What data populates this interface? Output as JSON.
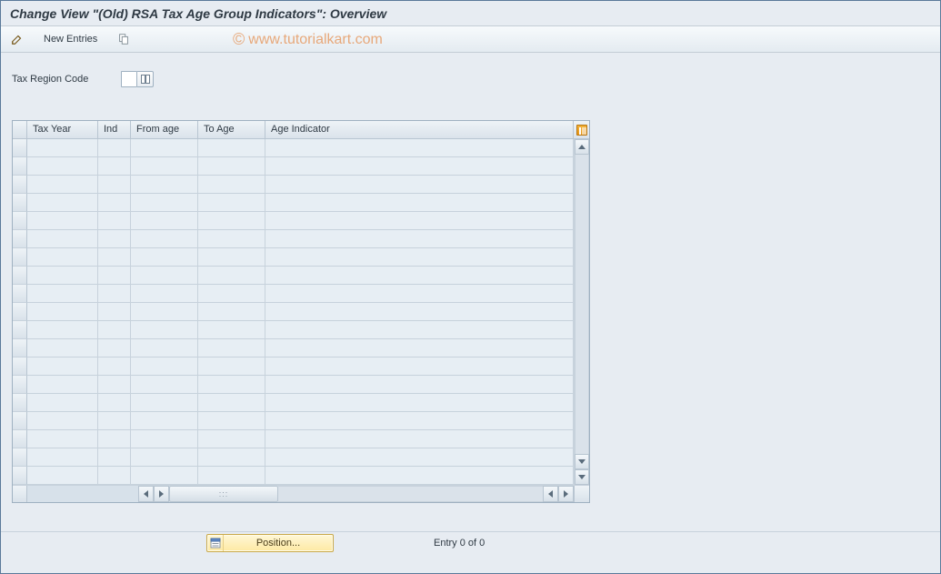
{
  "title": "Change View \"(Old) RSA Tax Age Group Indicators\": Overview",
  "toolbar": {
    "new_entries_label": "New Entries"
  },
  "watermark": "www.tutorialkart.com",
  "form": {
    "tax_region_label": "Tax Region Code",
    "tax_region_value": ""
  },
  "table": {
    "columns": {
      "tax_year": "Tax Year",
      "ind": "Ind",
      "from_age": "From age",
      "to_age": "To Age",
      "age_indicator": "Age Indicator"
    },
    "rows": [
      {
        "tax_year": "",
        "ind": "",
        "from_age": "",
        "to_age": "",
        "age_indicator": ""
      },
      {
        "tax_year": "",
        "ind": "",
        "from_age": "",
        "to_age": "",
        "age_indicator": ""
      },
      {
        "tax_year": "",
        "ind": "",
        "from_age": "",
        "to_age": "",
        "age_indicator": ""
      },
      {
        "tax_year": "",
        "ind": "",
        "from_age": "",
        "to_age": "",
        "age_indicator": ""
      },
      {
        "tax_year": "",
        "ind": "",
        "from_age": "",
        "to_age": "",
        "age_indicator": ""
      },
      {
        "tax_year": "",
        "ind": "",
        "from_age": "",
        "to_age": "",
        "age_indicator": ""
      },
      {
        "tax_year": "",
        "ind": "",
        "from_age": "",
        "to_age": "",
        "age_indicator": ""
      },
      {
        "tax_year": "",
        "ind": "",
        "from_age": "",
        "to_age": "",
        "age_indicator": ""
      },
      {
        "tax_year": "",
        "ind": "",
        "from_age": "",
        "to_age": "",
        "age_indicator": ""
      },
      {
        "tax_year": "",
        "ind": "",
        "from_age": "",
        "to_age": "",
        "age_indicator": ""
      },
      {
        "tax_year": "",
        "ind": "",
        "from_age": "",
        "to_age": "",
        "age_indicator": ""
      },
      {
        "tax_year": "",
        "ind": "",
        "from_age": "",
        "to_age": "",
        "age_indicator": ""
      },
      {
        "tax_year": "",
        "ind": "",
        "from_age": "",
        "to_age": "",
        "age_indicator": ""
      },
      {
        "tax_year": "",
        "ind": "",
        "from_age": "",
        "to_age": "",
        "age_indicator": ""
      },
      {
        "tax_year": "",
        "ind": "",
        "from_age": "",
        "to_age": "",
        "age_indicator": ""
      },
      {
        "tax_year": "",
        "ind": "",
        "from_age": "",
        "to_age": "",
        "age_indicator": ""
      },
      {
        "tax_year": "",
        "ind": "",
        "from_age": "",
        "to_age": "",
        "age_indicator": ""
      },
      {
        "tax_year": "",
        "ind": "",
        "from_age": "",
        "to_age": "",
        "age_indicator": ""
      },
      {
        "tax_year": "",
        "ind": "",
        "from_age": "",
        "to_age": "",
        "age_indicator": ""
      }
    ]
  },
  "footer": {
    "position_label": "Position...",
    "entry_text": "Entry 0 of 0"
  }
}
